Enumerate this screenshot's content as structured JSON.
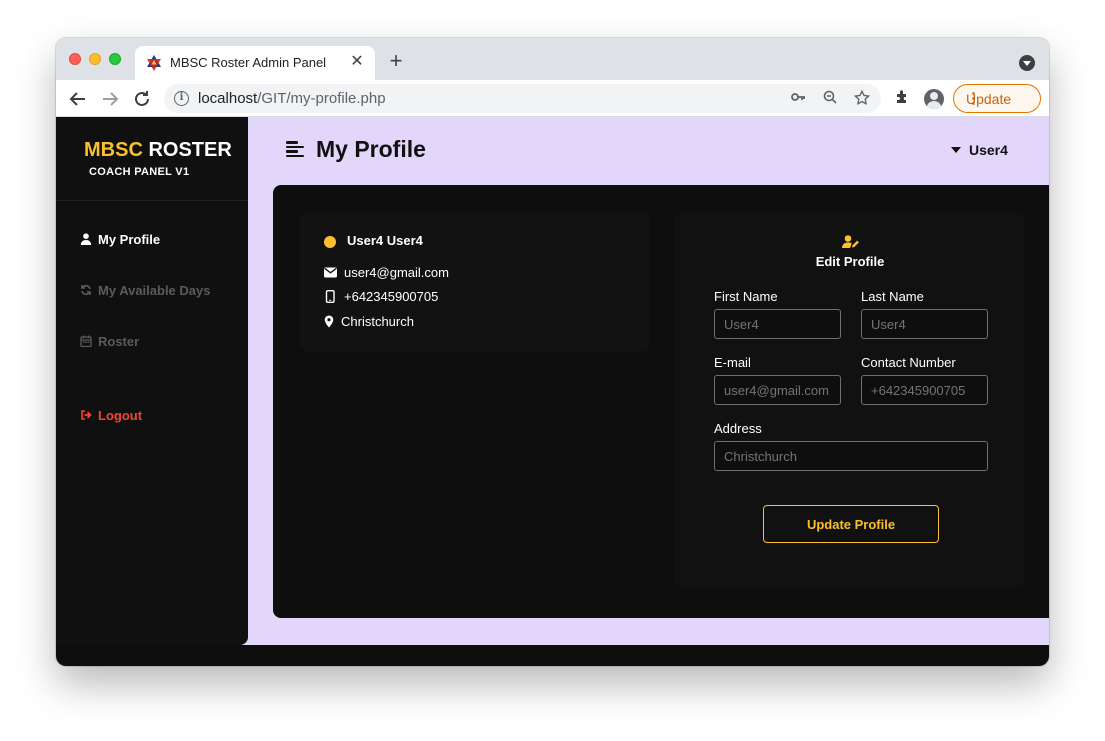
{
  "browser": {
    "tab_title": "MBSC Roster Admin Panel",
    "tab_close": "✕",
    "new_tab": "+",
    "url_host": "localhost",
    "url_path": "/GIT/my-profile.php",
    "update_label": "Update",
    "menu_dots": "⋮"
  },
  "sidebar": {
    "brand_accent": "MBSC",
    "brand_main": "ROSTER",
    "brand_sub": "COACH PANEL V1",
    "items": [
      {
        "label": "My Profile",
        "icon": "user-icon",
        "state": "active"
      },
      {
        "label": "My Available Days",
        "icon": "refresh-icon",
        "state": "muted"
      },
      {
        "label": "Roster",
        "icon": "calendar-icon",
        "state": "muted"
      },
      {
        "label": "Logout",
        "icon": "logout-icon",
        "state": "danger"
      }
    ]
  },
  "header": {
    "title": "My Profile",
    "user_name": "User4"
  },
  "profile_card": {
    "name": "User4 User4",
    "email": "user4@gmail.com",
    "phone": "+642345900705",
    "location": "Christchurch",
    "status_color": "#fbc02d"
  },
  "edit_form": {
    "title": "Edit Profile",
    "first_name_label": "First Name",
    "first_name_placeholder": "User4",
    "last_name_label": "Last Name",
    "last_name_placeholder": "User4",
    "email_label": "E-mail",
    "email_placeholder": "user4@gmail.com",
    "contact_label": "Contact Number",
    "contact_placeholder": "+642345900705",
    "address_label": "Address",
    "address_placeholder": "Christchurch",
    "submit_label": "Update Profile"
  },
  "colors": {
    "accent": "#fbc02d",
    "page_bg": "#e2d6fb",
    "panel_bg": "#0e0e0e",
    "danger": "#f44336"
  }
}
